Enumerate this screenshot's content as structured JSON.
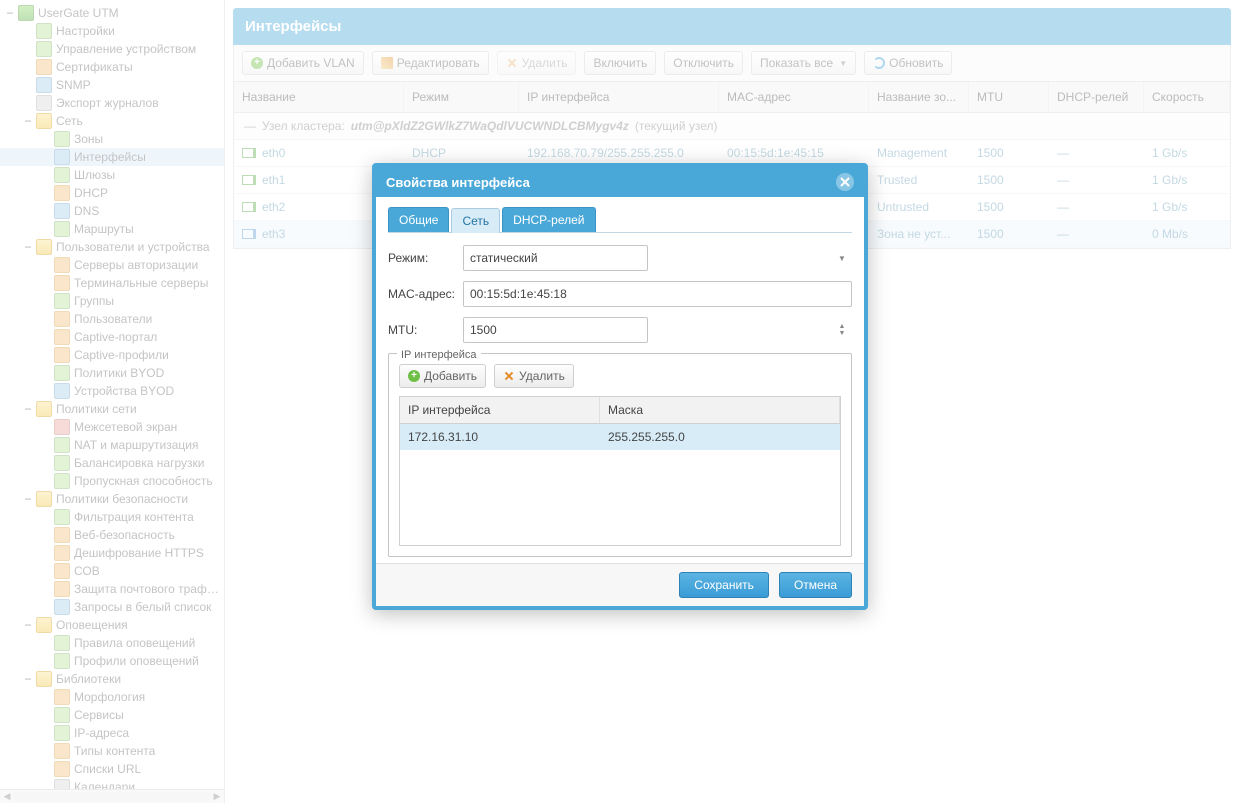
{
  "sidebar": {
    "nodes": [
      {
        "depth": 0,
        "toggle": "−",
        "icon": "root",
        "label": "UserGate UTM",
        "interact": true
      },
      {
        "depth": 1,
        "toggle": "",
        "icon": "leaf-green",
        "label": "Настройки",
        "interact": true
      },
      {
        "depth": 1,
        "toggle": "",
        "icon": "leaf-green",
        "label": "Управление устройством",
        "interact": true
      },
      {
        "depth": 1,
        "toggle": "",
        "icon": "leaf-orange",
        "label": "Сертификаты",
        "interact": true
      },
      {
        "depth": 1,
        "toggle": "",
        "icon": "leaf-blue",
        "label": "SNMP",
        "interact": true
      },
      {
        "depth": 1,
        "toggle": "",
        "icon": "leaf-grey",
        "label": "Экспорт журналов",
        "interact": true
      },
      {
        "depth": 1,
        "toggle": "−",
        "icon": "folder",
        "label": "Сеть",
        "interact": true
      },
      {
        "depth": 2,
        "toggle": "",
        "icon": "leaf-green",
        "label": "Зоны",
        "interact": true
      },
      {
        "depth": 2,
        "toggle": "",
        "icon": "leaf-blue",
        "label": "Интерфейсы",
        "interact": true,
        "selected": true
      },
      {
        "depth": 2,
        "toggle": "",
        "icon": "leaf-green",
        "label": "Шлюзы",
        "interact": true
      },
      {
        "depth": 2,
        "toggle": "",
        "icon": "leaf-orange",
        "label": "DHCP",
        "interact": true
      },
      {
        "depth": 2,
        "toggle": "",
        "icon": "leaf-blue",
        "label": "DNS",
        "interact": true
      },
      {
        "depth": 2,
        "toggle": "",
        "icon": "leaf-green",
        "label": "Маршруты",
        "interact": true
      },
      {
        "depth": 1,
        "toggle": "−",
        "icon": "folder",
        "label": "Пользователи и устройства",
        "interact": true
      },
      {
        "depth": 2,
        "toggle": "",
        "icon": "leaf-orange",
        "label": "Серверы авторизации",
        "interact": true
      },
      {
        "depth": 2,
        "toggle": "",
        "icon": "leaf-orange",
        "label": "Терминальные серверы",
        "interact": true
      },
      {
        "depth": 2,
        "toggle": "",
        "icon": "leaf-green",
        "label": "Группы",
        "interact": true
      },
      {
        "depth": 2,
        "toggle": "",
        "icon": "leaf-orange",
        "label": "Пользователи",
        "interact": true
      },
      {
        "depth": 2,
        "toggle": "",
        "icon": "leaf-orange",
        "label": "Captive-портал",
        "interact": true
      },
      {
        "depth": 2,
        "toggle": "",
        "icon": "leaf-orange",
        "label": "Captive-профили",
        "interact": true
      },
      {
        "depth": 2,
        "toggle": "",
        "icon": "leaf-green",
        "label": "Политики BYOD",
        "interact": true
      },
      {
        "depth": 2,
        "toggle": "",
        "icon": "leaf-blue",
        "label": "Устройства BYOD",
        "interact": true
      },
      {
        "depth": 1,
        "toggle": "−",
        "icon": "folder",
        "label": "Политики сети",
        "interact": true
      },
      {
        "depth": 2,
        "toggle": "",
        "icon": "leaf-red",
        "label": "Межсетевой экран",
        "interact": true
      },
      {
        "depth": 2,
        "toggle": "",
        "icon": "leaf-green",
        "label": "NAT и маршрутизация",
        "interact": true
      },
      {
        "depth": 2,
        "toggle": "",
        "icon": "leaf-green",
        "label": "Балансировка нагрузки",
        "interact": true
      },
      {
        "depth": 2,
        "toggle": "",
        "icon": "leaf-green",
        "label": "Пропускная способность",
        "interact": true
      },
      {
        "depth": 1,
        "toggle": "−",
        "icon": "folder",
        "label": "Политики безопасности",
        "interact": true
      },
      {
        "depth": 2,
        "toggle": "",
        "icon": "leaf-green",
        "label": "Фильтрация контента",
        "interact": true
      },
      {
        "depth": 2,
        "toggle": "",
        "icon": "leaf-orange",
        "label": "Веб-безопасность",
        "interact": true
      },
      {
        "depth": 2,
        "toggle": "",
        "icon": "leaf-orange",
        "label": "Дешифрование HTTPS",
        "interact": true
      },
      {
        "depth": 2,
        "toggle": "",
        "icon": "leaf-orange",
        "label": "СОВ",
        "interact": true
      },
      {
        "depth": 2,
        "toggle": "",
        "icon": "leaf-orange",
        "label": "Защита почтового трафика",
        "interact": true
      },
      {
        "depth": 2,
        "toggle": "",
        "icon": "leaf-blue",
        "label": "Запросы в белый список",
        "interact": true
      },
      {
        "depth": 1,
        "toggle": "−",
        "icon": "folder",
        "label": "Оповещения",
        "interact": true
      },
      {
        "depth": 2,
        "toggle": "",
        "icon": "leaf-green",
        "label": "Правила оповещений",
        "interact": true
      },
      {
        "depth": 2,
        "toggle": "",
        "icon": "leaf-green",
        "label": "Профили оповещений",
        "interact": true
      },
      {
        "depth": 1,
        "toggle": "−",
        "icon": "folder",
        "label": "Библиотеки",
        "interact": true
      },
      {
        "depth": 2,
        "toggle": "",
        "icon": "leaf-orange",
        "label": "Морфология",
        "interact": true
      },
      {
        "depth": 2,
        "toggle": "",
        "icon": "leaf-green",
        "label": "Сервисы",
        "interact": true
      },
      {
        "depth": 2,
        "toggle": "",
        "icon": "leaf-green",
        "label": "IP-адреса",
        "interact": true
      },
      {
        "depth": 2,
        "toggle": "",
        "icon": "leaf-orange",
        "label": "Типы контента",
        "interact": true
      },
      {
        "depth": 2,
        "toggle": "",
        "icon": "leaf-orange",
        "label": "Списки URL",
        "interact": true
      },
      {
        "depth": 2,
        "toggle": "",
        "icon": "leaf-grey",
        "label": "Календари",
        "interact": true
      }
    ]
  },
  "panel": {
    "title": "Интерфейсы"
  },
  "toolbar": {
    "add_vlan": "Добавить VLAN",
    "edit": "Редактировать",
    "delete": "Удалить",
    "enable": "Включить",
    "disable": "Отключить",
    "show_all": "Показать все",
    "refresh": "Обновить"
  },
  "grid": {
    "cols": {
      "name": "Название",
      "mode": "Режим",
      "ip": "IP интерфейса",
      "mac": "MAC-адрес",
      "zone": "Название зо...",
      "mtu": "MTU",
      "relay": "DHCP-релей",
      "speed": "Скорость"
    },
    "group_prefix": "Узел кластера: ",
    "group_id": "utm@pXldZ2GWlkZ7WaQdlVUCWNDLCBMygv4z",
    "group_suffix": " (текущий узел)",
    "rows": [
      {
        "name": "eth0",
        "mode": "DHCP",
        "ip": "192.168.70.79/255.255.255.0",
        "mac": "00:15:5d:1e:45:15",
        "zone": "Management",
        "mtu": "1500",
        "relay": "—",
        "speed": "1 Gb/s",
        "icon": "green"
      },
      {
        "name": "eth1",
        "mode": "",
        "ip": "",
        "mac": "",
        "zone": "Trusted",
        "mtu": "1500",
        "relay": "—",
        "speed": "1 Gb/s",
        "icon": "green"
      },
      {
        "name": "eth2",
        "mode": "",
        "ip": "",
        "mac": "",
        "zone": "Untrusted",
        "mtu": "1500",
        "relay": "—",
        "speed": "1 Gb/s",
        "icon": "green"
      },
      {
        "name": "eth3",
        "mode": "",
        "ip": "",
        "mac": "",
        "zone": "Зона не уст...",
        "mtu": "1500",
        "relay": "—",
        "speed": "0 Mb/s",
        "icon": "blue",
        "selected": true
      }
    ]
  },
  "dialog": {
    "title": "Свойства интерфейса",
    "tabs": {
      "general": "Общие",
      "network": "Сеть",
      "dhcprelay": "DHCP-релей"
    },
    "active_tab": "network",
    "fields": {
      "mode_label": "Режим:",
      "mode_value": "статический",
      "mac_label": "MAC-адрес:",
      "mac_value": "00:15:5d:1e:45:18",
      "mtu_label": "MTU:",
      "mtu_value": "1500"
    },
    "fieldset_legend": "IP интерфейса",
    "fs_add": "Добавить",
    "fs_del": "Удалить",
    "inner_cols": {
      "ip": "IP интерфейса",
      "mask": "Маска"
    },
    "inner_row": {
      "ip": "172.16.31.10",
      "mask": "255.255.255.0"
    },
    "save": "Сохранить",
    "cancel": "Отмена"
  }
}
